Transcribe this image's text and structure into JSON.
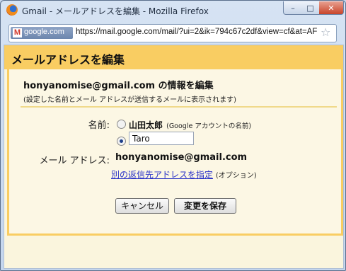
{
  "window": {
    "title": "Gmail - メールアドレスを編集 - Mozilla Firefox",
    "controls": {
      "minimize": "–",
      "maximize": "□",
      "close": "✕"
    }
  },
  "addressbar": {
    "site_domain": "google.com",
    "url": "https://mail.google.com/mail/?ui=2&ik=794c67c2df&view=cf&at=AF"
  },
  "page": {
    "header_title": "メールアドレスを編集",
    "section_title": "honyanomise@gmail.com の情報を編集",
    "section_subtitle": "(設定した名前とメール アドレスが送信するメールに表示されます)",
    "name_label": "名前:",
    "option_account_name": "山田太郎",
    "option_account_note": "(Google アカウントの名前)",
    "custom_name_value": "Taro",
    "email_label": "メール アドレス:",
    "email_value": "honyanomise@gmail.com",
    "alt_reply_link": "別の返信先アドレスを指定",
    "alt_reply_note": "(オプション)",
    "cancel_label": "キャンセル",
    "save_label": "変更を保存"
  },
  "colors": {
    "header_bg": "#f9cd62",
    "panel_bg": "#fcf7e4",
    "link": "#2a33c8"
  },
  "icons": [
    "firefox-icon",
    "gmail-icon",
    "star-icon",
    "minimize-icon",
    "maximize-icon",
    "close-icon"
  ]
}
